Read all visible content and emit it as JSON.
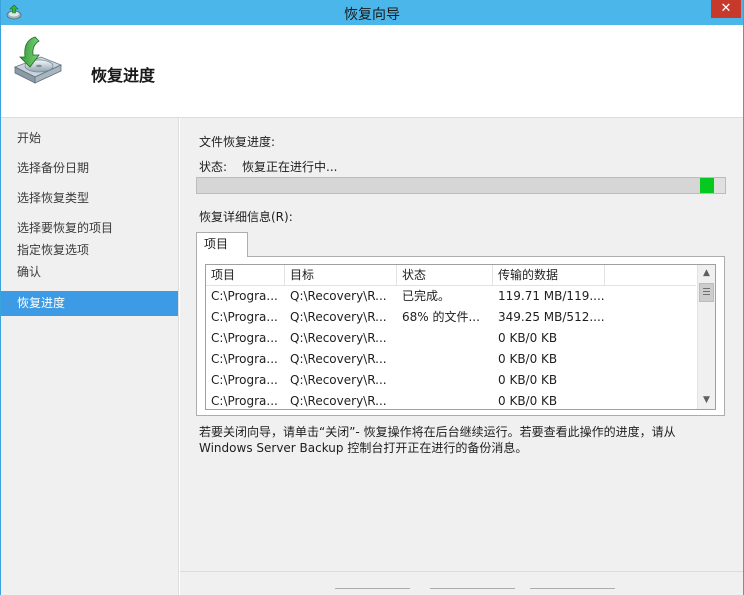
{
  "window": {
    "title": "恢复向导",
    "close_glyph": "✕"
  },
  "header": {
    "title": "恢复进度",
    "icon": "backup-disk-icon"
  },
  "sidebar": {
    "items": [
      {
        "label": "开始",
        "active": false
      },
      {
        "label": "选择备份日期",
        "active": false
      },
      {
        "label": "选择恢复类型",
        "active": false
      },
      {
        "label": "选择要恢复的项目",
        "active": false
      },
      {
        "label": "指定恢复选项",
        "active": false
      },
      {
        "label": "确认",
        "active": false
      },
      {
        "label": "恢复进度",
        "active": true
      }
    ]
  },
  "main": {
    "file_progress_label": "文件恢复进度:",
    "status_label": "状态:",
    "status_value": "恢复正在进行中...",
    "progress_fraction": 0.98,
    "details_label": "恢复详细信息(R):",
    "tab_label": "项目",
    "table": {
      "columns": [
        "项目",
        "目标",
        "状态",
        "传输的数据"
      ],
      "rows": [
        [
          "C:\\Progra...",
          "Q:\\Recovery\\R...",
          "已完成。",
          "119.71 MB/119...."
        ],
        [
          "C:\\Progra...",
          "Q:\\Recovery\\R...",
          "68% 的文件...",
          "349.25 MB/512...."
        ],
        [
          "C:\\Progra...",
          "Q:\\Recovery\\R...",
          "",
          "0 KB/0 KB"
        ],
        [
          "C:\\Progra...",
          "Q:\\Recovery\\R...",
          "",
          "0 KB/0 KB"
        ],
        [
          "C:\\Progra...",
          "Q:\\Recovery\\R...",
          "",
          "0 KB/0 KB"
        ],
        [
          "C:\\Progra...",
          "Q:\\Recovery\\R...",
          "",
          "0 KB/0 KB"
        ]
      ]
    },
    "note_line1": "若要关闭向导，请单击“关闭”- 恢复操作将在后台继续运行。若要查看此操作的进度，请从",
    "note_line2": "Windows Server Backup 控制台打开正在进行的备份消息。"
  },
  "colors": {
    "title_bar": "#4ab6ea",
    "active_item": "#3c9be4",
    "progress_tip": "#06c81f",
    "close": "#c7392b"
  }
}
